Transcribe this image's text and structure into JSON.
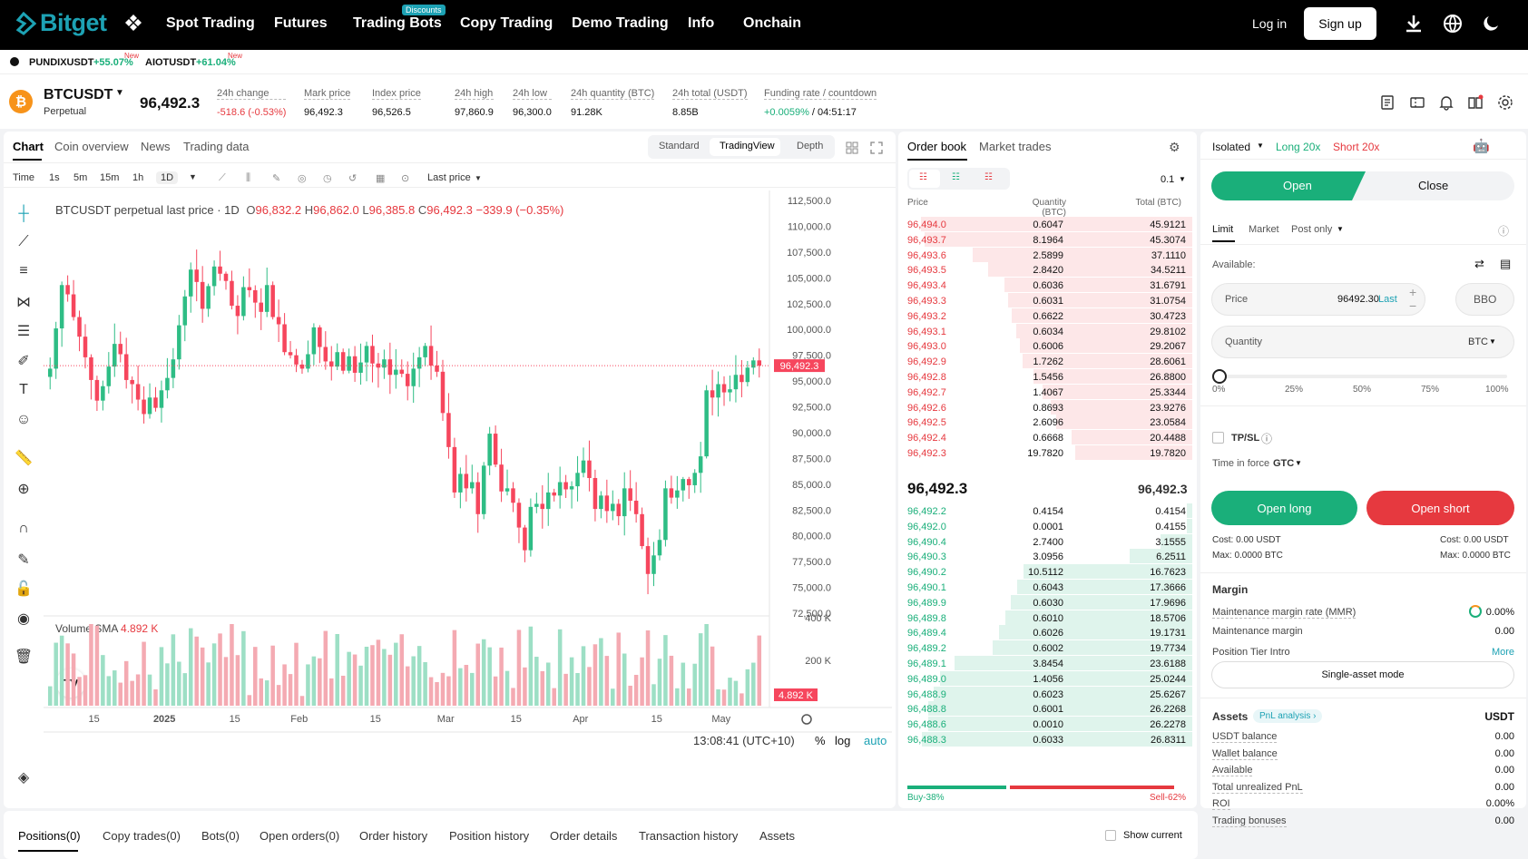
{
  "nav": {
    "brand": "Bitget",
    "items": [
      "Spot Trading",
      "Futures",
      "Trading Bots",
      "Copy Trading",
      "Demo Trading",
      "Info",
      "Onchain"
    ],
    "badge": "Discounts",
    "login": "Log in",
    "signup": "Sign up",
    "icons": [
      "download-icon",
      "globe-icon",
      "theme-moon-icon"
    ]
  },
  "ticker": [
    {
      "symbol": "PUNDIXUSDT",
      "change": "+55.07%",
      "tag": "New"
    },
    {
      "symbol": "AIOTUSDT",
      "change": "+61.04%",
      "tag": "New"
    }
  ],
  "info": {
    "symbol": "BTCUSDT",
    "type": "Perpetual",
    "last_price": "96,492.3",
    "stats": [
      {
        "label": "24h change",
        "value": "-518.6 (-0.53%)",
        "color": "red"
      },
      {
        "label": "Mark price",
        "value": "96,492.3"
      },
      {
        "label": "Index price",
        "value": "96,526.5"
      },
      {
        "label": "24h high",
        "value": "97,860.9"
      },
      {
        "label": "24h low",
        "value": "96,300.0"
      },
      {
        "label": "24h quantity (BTC)",
        "value": "91.28K"
      },
      {
        "label": "24h total (USDT)",
        "value": "8.85B"
      },
      {
        "label": "Funding rate / countdown",
        "value_green": "+0.0059%",
        "value": "/ 04:51:17"
      }
    ]
  },
  "chart_tabs": [
    "Chart",
    "Coin overview",
    "News",
    "Trading data"
  ],
  "chart_modes": [
    "Standard",
    "TradingView",
    "Depth"
  ],
  "timeframes": [
    "Time",
    "1s",
    "5m",
    "15m",
    "1h",
    "1D"
  ],
  "price_type": "Last price",
  "legend": {
    "title": "BTCUSDT perpetual last price · 1D",
    "o": "96,832.2",
    "h": "96,862.0",
    "l": "96,385.8",
    "c": "96,492.3",
    "chg": "−339.9 (−0.35%)",
    "volume_label": "Volume SMA",
    "volume_value": "4.892 K"
  },
  "chart_data": {
    "type": "candlestick",
    "title": "BTCUSDT perpetual last price · 1D",
    "y_ticks": [
      "112,500.0",
      "110,000.0",
      "107,500.0",
      "105,000.0",
      "102,500.0",
      "100,000.0",
      "97,500.0",
      "95,000.0",
      "92,500.0",
      "90,000.0",
      "87,500.0",
      "85,000.0",
      "82,500.0",
      "80,000.0",
      "77,500.0",
      "75,000.0",
      "72,500.0"
    ],
    "ylim": [
      72500,
      112500
    ],
    "x_ticks": [
      "15",
      "2025",
      "15",
      "Feb",
      "15",
      "Mar",
      "15",
      "Apr",
      "15",
      "May"
    ],
    "last_price_label": "96,492.3",
    "volume_ticks": [
      "400 K",
      "200 K"
    ],
    "volume_last_label": "4.892 K",
    "series": [
      {
        "name": "close",
        "values": [
          96200,
          100100,
          104300,
          103400,
          101200,
          99300,
          97300,
          95100,
          93100,
          94500,
          96400,
          98600,
          97600,
          95100,
          94700,
          93200,
          91800,
          93400,
          92400,
          94100,
          95300,
          97100,
          100400,
          103200,
          105800,
          104600,
          102000,
          104200,
          106100,
          105400,
          104700,
          102300,
          101300,
          104100,
          103800,
          102600,
          101700,
          104300,
          101200,
          100500,
          97800,
          97500,
          96600,
          96200,
          97600,
          100200,
          98300,
          96900,
          96400,
          97800,
          96000,
          97400,
          95800,
          96800,
          98400,
          96700,
          96300,
          97100,
          95600,
          96100,
          95700,
          94500,
          96200,
          97300,
          98400,
          96500,
          95900,
          91900,
          88600,
          84200,
          86000,
          84600,
          85200,
          82100,
          86800,
          89900,
          86900,
          84300,
          84600,
          83200,
          80800,
          78600,
          82800,
          83100,
          82600,
          84200,
          83900,
          85200,
          84500,
          84800,
          86100,
          87300,
          85600,
          82600,
          83900,
          82400,
          83100,
          81900,
          84600,
          83400,
          82100,
          79000,
          76300,
          78100,
          79600,
          84600,
          83700,
          84400,
          85500,
          84900,
          86100,
          87700,
          94100,
          93400,
          94700,
          93900,
          94200,
          95600,
          94900,
          96300,
          97000,
          96492
        ]
      }
    ],
    "current_time": "13:08:41 (UTC+10)",
    "scale_opts": [
      "%",
      "log",
      "auto"
    ]
  },
  "orderbook": {
    "tabs": [
      "Order book",
      "Market trades"
    ],
    "precision": "0.1",
    "headers": [
      "Price",
      "Quantity (BTC)",
      "Total (BTC)"
    ],
    "asks": [
      [
        "96,494.0",
        "0.6047",
        "45.9121"
      ],
      [
        "96,493.7",
        "8.1964",
        "45.3074"
      ],
      [
        "96,493.6",
        "2.5899",
        "37.1110"
      ],
      [
        "96,493.5",
        "2.8420",
        "34.5211"
      ],
      [
        "96,493.4",
        "0.6036",
        "31.6791"
      ],
      [
        "96,493.3",
        "0.6031",
        "31.0754"
      ],
      [
        "96,493.2",
        "0.6622",
        "30.4723"
      ],
      [
        "96,493.1",
        "0.6034",
        "29.8102"
      ],
      [
        "96,493.0",
        "0.6006",
        "29.2067"
      ],
      [
        "96,492.9",
        "1.7262",
        "28.6061"
      ],
      [
        "96,492.8",
        "1.5456",
        "26.8800"
      ],
      [
        "96,492.7",
        "1.4067",
        "25.3344"
      ],
      [
        "96,492.6",
        "0.8693",
        "23.9276"
      ],
      [
        "96,492.5",
        "2.6096",
        "23.0584"
      ],
      [
        "96,492.4",
        "0.6668",
        "20.4488"
      ],
      [
        "96,492.3",
        "19.7820",
        "19.7820"
      ]
    ],
    "mid_price": "96,492.3",
    "mid_mark": "96,492.3",
    "bids": [
      [
        "96,492.2",
        "0.4154",
        "0.4154"
      ],
      [
        "96,492.0",
        "0.0001",
        "0.4155"
      ],
      [
        "96,490.4",
        "2.7400",
        "3.1555"
      ],
      [
        "96,490.3",
        "3.0956",
        "6.2511"
      ],
      [
        "96,490.2",
        "10.5112",
        "16.7623"
      ],
      [
        "96,490.1",
        "0.6043",
        "17.3666"
      ],
      [
        "96,489.9",
        "0.6030",
        "17.9696"
      ],
      [
        "96,489.8",
        "0.6010",
        "18.5706"
      ],
      [
        "96,489.4",
        "0.6026",
        "19.1731"
      ],
      [
        "96,489.2",
        "0.6002",
        "19.7734"
      ],
      [
        "96,489.1",
        "3.8454",
        "23.6188"
      ],
      [
        "96,489.0",
        "1.4056",
        "25.0244"
      ],
      [
        "96,488.9",
        "0.6023",
        "25.6267"
      ],
      [
        "96,488.8",
        "0.6001",
        "26.2268"
      ],
      [
        "96,488.6",
        "0.0010",
        "26.2278"
      ],
      [
        "96,488.3",
        "0.6033",
        "26.8311"
      ]
    ],
    "buy_pct": "Buy-38%",
    "sell_pct": "Sell-62%",
    "buy_ratio": 0.38
  },
  "trade": {
    "margin_mode": "Isolated",
    "long": "Long 20x",
    "short": "Short 20x",
    "open": "Open",
    "close": "Close",
    "order_types": [
      "Limit",
      "Market",
      "Post only"
    ],
    "available": "Available:",
    "price_label": "Price",
    "price_value": "96492.30",
    "price_last": "Last",
    "bbo": "BBO",
    "qty_label": "Quantity",
    "qty_unit": "BTC",
    "slider_marks": [
      "0%",
      "25%",
      "50%",
      "75%",
      "100%"
    ],
    "tpsl": "TP/SL",
    "tif_label": "Time in force",
    "tif_value": "GTC",
    "open_long": "Open long",
    "open_short": "Open short",
    "cost_left": "Cost: 0.00 USDT",
    "max_left": "Max: 0.0000 BTC",
    "cost_right": "Cost: 0.00 USDT",
    "max_right": "Max: 0.0000 BTC",
    "margin_title": "Margin",
    "mmr_label": "Maintenance margin rate (MMR)",
    "mmr_value": "0.00%",
    "mm_label": "Maintenance margin",
    "mm_value": "0.00",
    "tier_label": "Position Tier Intro",
    "tier_link": "More",
    "single_asset": "Single-asset mode",
    "assets_title": "Assets",
    "pnl_analysis": "PnL analysis ›",
    "assets_ccy": "USDT",
    "asset_rows": [
      [
        "USDT balance",
        "0.00"
      ],
      [
        "Wallet balance",
        "0.00"
      ],
      [
        "Available",
        "0.00"
      ],
      [
        "Total unrealized PnL",
        "0.00"
      ],
      [
        "ROI",
        "0.00%"
      ],
      [
        "Trading bonuses",
        "0.00"
      ]
    ]
  },
  "bottom_tabs": [
    "Positions(0)",
    "Copy trades(0)",
    "Bots(0)",
    "Open orders(0)",
    "Order history",
    "Position history",
    "Order details",
    "Transaction history",
    "Assets"
  ],
  "show_current": "Show current"
}
